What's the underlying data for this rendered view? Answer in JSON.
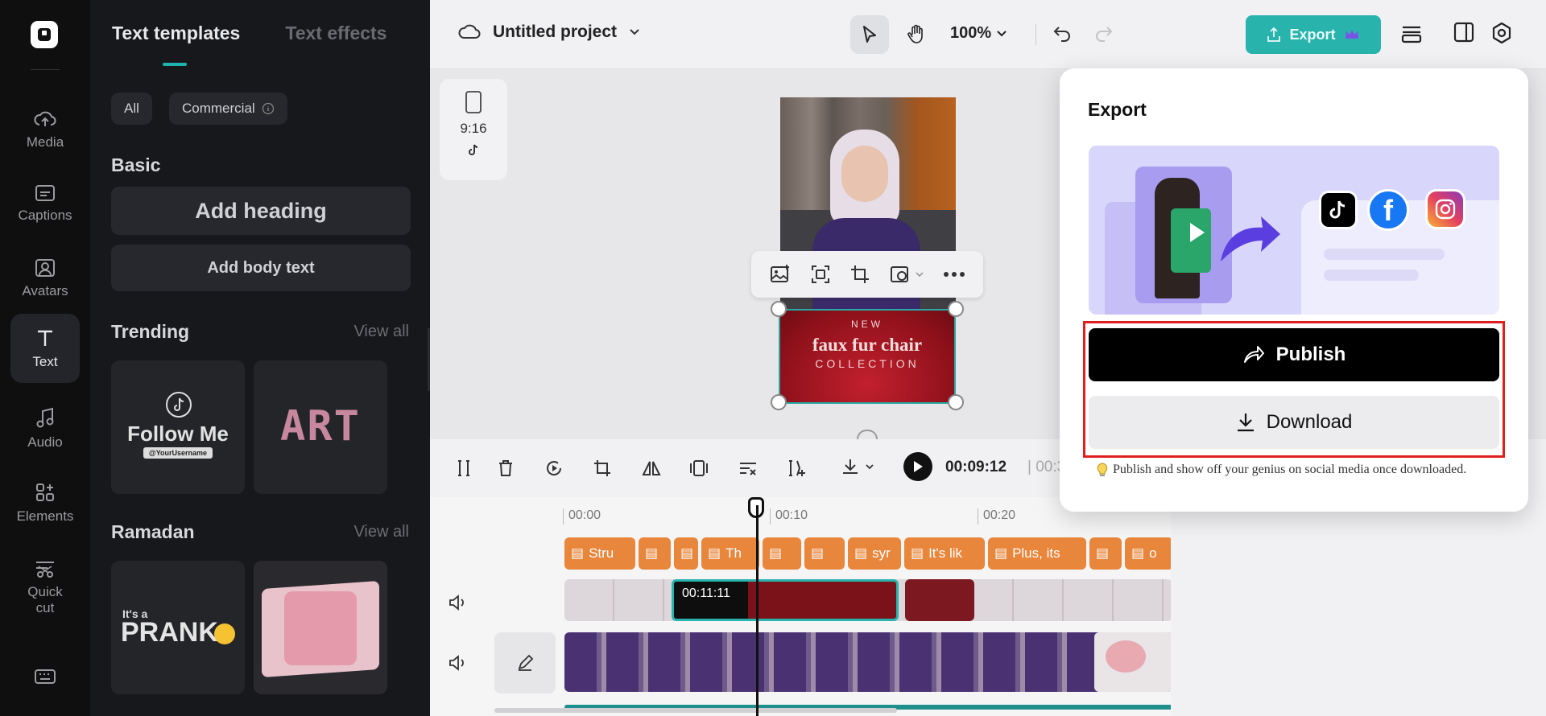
{
  "rail": {
    "items": [
      {
        "label": "Media",
        "icon": "cloud-upload-icon"
      },
      {
        "label": "Captions",
        "icon": "captions-icon"
      },
      {
        "label": "Avatars",
        "icon": "avatar-icon"
      },
      {
        "label": "Text",
        "icon": "text-icon"
      },
      {
        "label": "Audio",
        "icon": "music-icon"
      },
      {
        "label": "Elements",
        "icon": "elements-icon"
      },
      {
        "label": "Quick",
        "label2": "cut",
        "icon": "quick-cut-icon"
      }
    ]
  },
  "panel": {
    "tab_active": "Text templates",
    "tab_inactive": "Text effects",
    "chip_all": "All",
    "chip_commercial": "Commercial",
    "basic_title": "Basic",
    "add_heading": "Add heading",
    "add_body": "Add body text",
    "trending_title": "Trending",
    "ramadan_title": "Ramadan",
    "view_all": "View all",
    "follow_title": "Follow Me",
    "follow_handle": "@YourUsername",
    "art_text": "ART",
    "prank_small": "It's a",
    "prank_big": "PRANK"
  },
  "topbar": {
    "project_title": "Untitled project",
    "zoom": "100%",
    "export_label": "Export"
  },
  "canvas": {
    "ratio_label": "9:16",
    "overlay_new": "NEW",
    "overlay_title": "faux fur chair",
    "overlay_sub": "COLLECTION"
  },
  "timeline": {
    "timecode": "00:09:12",
    "timecode_rest": "| 00:3",
    "ruler": [
      "00:00",
      "00:10",
      "00:20"
    ],
    "clip_time": "00:11:11",
    "captions": [
      "Stru",
      "",
      "",
      "Th",
      "",
      "",
      "syr",
      "It's lik",
      "Plus, its",
      "",
      "o"
    ]
  },
  "export_modal": {
    "title": "Export",
    "publish_label": "Publish",
    "download_label": "Download",
    "hint": "Publish and show off your genius on social media once downloaded."
  },
  "colors": {
    "accent": "#29b3ad",
    "caption_clip": "#e8863c",
    "highlight": "#e01e1e"
  }
}
